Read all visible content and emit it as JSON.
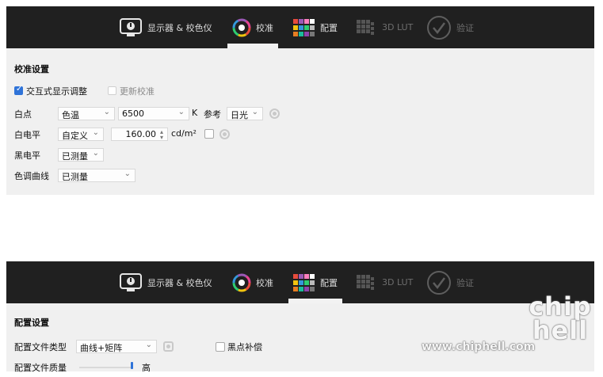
{
  "panel_top": {
    "tabs": [
      {
        "label": "显示器 & 校色仪",
        "icon": "monitor-icon"
      },
      {
        "label": "校准",
        "icon": "color-wheel-icon"
      },
      {
        "label": "配置",
        "icon": "palette-grid-icon"
      },
      {
        "label": "3D LUT",
        "icon": "lut-cube-icon"
      },
      {
        "label": "验证",
        "icon": "check-circle-icon"
      }
    ],
    "active_tab": "校准",
    "section_title": "校准设置",
    "interactive_adjust": {
      "label": "交互式显示调整",
      "checked": true
    },
    "update_calibration": {
      "label": "更新校准",
      "checked": false
    },
    "whitepoint": {
      "label": "白点",
      "mode": "色温",
      "value": "6500",
      "unit": "K",
      "ref_label": "参考",
      "ref_value": "日光"
    },
    "white_level": {
      "label": "白电平",
      "mode": "自定义",
      "value": "160.00",
      "unit": "cd/m²"
    },
    "black_level": {
      "label": "黑电平",
      "mode": "已测量"
    },
    "tone_curve": {
      "label": "色调曲线",
      "mode": "已测量"
    }
  },
  "panel_bottom": {
    "tabs": [
      {
        "label": "显示器 & 校色仪",
        "icon": "monitor-icon"
      },
      {
        "label": "校准",
        "icon": "color-wheel-icon"
      },
      {
        "label": "配置",
        "icon": "palette-grid-icon"
      },
      {
        "label": "3D LUT",
        "icon": "lut-cube-icon"
      },
      {
        "label": "验证",
        "icon": "check-circle-icon"
      }
    ],
    "active_tab": "配置",
    "section_title": "配置设置",
    "profile_type": {
      "label": "配置文件类型",
      "value": "曲线+矩阵"
    },
    "black_point_comp": {
      "label": "黑点补偿",
      "checked": false
    },
    "profile_quality": {
      "label": "配置文件质量",
      "value": "高",
      "level": 1.0
    }
  },
  "watermark": {
    "url": "www.chiphell.com",
    "logo_text": "chip hell"
  },
  "colors": {
    "tabbar": "#202020",
    "panel_bg": "#f0f0f0",
    "accent": "#2f73d8"
  }
}
